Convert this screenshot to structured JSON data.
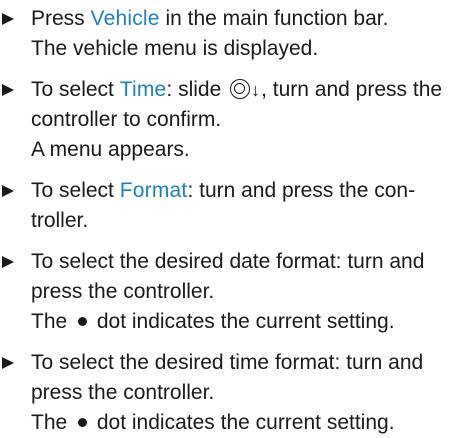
{
  "steps": [
    {
      "pre": "Press ",
      "keyword": "Vehicle",
      "post": " in the main function bar.",
      "result": "The vehicle menu is displayed."
    },
    {
      "pre": "To select ",
      "keyword": "Time",
      "mid": ": slide ",
      "post": ", turn and press the controller to confirm.",
      "result": "A menu appears."
    },
    {
      "pre": "To select ",
      "keyword": "Format",
      "post": ": turn and press the con-troller."
    },
    {
      "text": "To select the desired date format: turn and press the controller.",
      "result_pre": "The ",
      "result_post": " dot indicates the current setting."
    },
    {
      "text": "To select the desired time format: turn and press the controller.",
      "result_pre": "The ",
      "result_post": " dot indicates the current setting."
    }
  ],
  "icons": {
    "bullet": "triangle-right-icon",
    "controller": "controller-icon",
    "slide_down": "arrow-down-icon",
    "current_setting": "filled-dot-icon"
  },
  "colors": {
    "text": "#1a1a1a",
    "keyword": "#1b7fc4"
  }
}
